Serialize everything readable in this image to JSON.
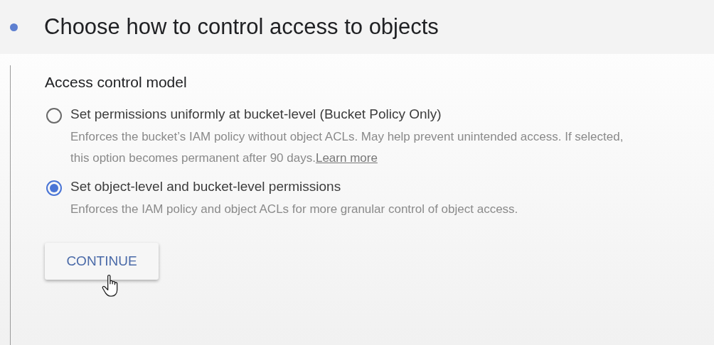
{
  "step": {
    "title": "Choose how to control access to objects"
  },
  "section": {
    "title": "Access control model"
  },
  "options": [
    {
      "label": "Set permissions uniformly at bucket-level (Bucket Policy Only)",
      "description": "Enforces the bucket’s IAM policy without object ACLs. May help prevent unintended access. If selected, this option becomes permanent after 90 days.",
      "link": "Learn more",
      "selected": false
    },
    {
      "label": "Set object-level and bucket-level permissions",
      "description": "Enforces the IAM policy and object ACLs for more granular control of object access.",
      "selected": true
    }
  ],
  "button": {
    "label": "CONTINUE"
  }
}
